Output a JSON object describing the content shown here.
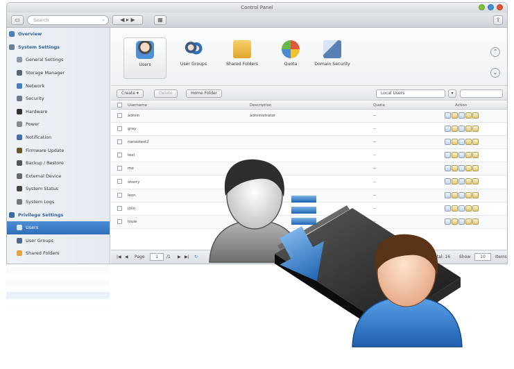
{
  "window": {
    "title": "Control Panel"
  },
  "toolbar": {
    "search_placeholder": "Search"
  },
  "sidebar": {
    "items": [
      {
        "label": "Overview",
        "level": "top",
        "icon": "overview-icon"
      },
      {
        "label": "System Settings",
        "level": "top",
        "icon": "gear-icon"
      },
      {
        "label": "General Settings",
        "level": "sub",
        "icon": "settings-icon"
      },
      {
        "label": "Storage Manager",
        "level": "sub",
        "icon": "storage-icon"
      },
      {
        "label": "Network",
        "level": "sub",
        "icon": "network-icon"
      },
      {
        "label": "Security",
        "level": "sub",
        "icon": "lock-icon"
      },
      {
        "label": "Hardware",
        "level": "sub",
        "icon": "hardware-icon"
      },
      {
        "label": "Power",
        "level": "sub",
        "icon": "power-icon"
      },
      {
        "label": "Notification",
        "level": "sub",
        "icon": "notification-icon"
      },
      {
        "label": "Firmware Update",
        "level": "sub",
        "icon": "firmware-icon"
      },
      {
        "label": "Backup / Restore",
        "level": "sub",
        "icon": "backup-icon"
      },
      {
        "label": "External Device",
        "level": "sub",
        "icon": "external-device-icon"
      },
      {
        "label": "System Status",
        "level": "sub",
        "icon": "status-icon"
      },
      {
        "label": "System Logs",
        "level": "sub",
        "icon": "logs-icon"
      },
      {
        "label": "Privilege Settings",
        "level": "top",
        "icon": "privilege-icon"
      },
      {
        "label": "Users",
        "level": "sub",
        "icon": "user-icon",
        "selected": true
      },
      {
        "label": "User Groups",
        "level": "sub",
        "icon": "user-group-icon"
      },
      {
        "label": "Shared Folders",
        "level": "sub",
        "icon": "folder-icon"
      }
    ]
  },
  "icons": [
    {
      "label": "Users",
      "color": "#f2dcc8"
    },
    {
      "label": "User Groups",
      "color": "#7a9cc2"
    },
    {
      "label": "Shared Folders",
      "color": "#e8b84a"
    },
    {
      "label": "Quota",
      "color": "#e05a3a"
    },
    {
      "label": "Domain Security",
      "color": "#5a7fb5"
    }
  ],
  "actions": {
    "create": "Create",
    "delete": "Delete",
    "home_folder": "Home Folder",
    "filter": "Local Users"
  },
  "grid": {
    "headers": {
      "username": "Username",
      "description": "Description",
      "quota": "Quota",
      "action": "Action"
    },
    "rows": [
      {
        "username": "admin",
        "description": "administrator",
        "quota": "--"
      },
      {
        "username": "gray",
        "description": "",
        "quota": "--"
      },
      {
        "username": "nanastest2",
        "description": "",
        "quota": "--"
      },
      {
        "username": "test",
        "description": "",
        "quota": "--"
      },
      {
        "username": "mo",
        "description": "",
        "quota": "--"
      },
      {
        "username": "sherry",
        "description": "",
        "quota": "--"
      },
      {
        "username": "leon",
        "description": "",
        "quota": "--"
      },
      {
        "username": "jolin",
        "description": "",
        "quota": "--"
      },
      {
        "username": "louie",
        "description": "",
        "quota": "--"
      }
    ]
  },
  "pager": {
    "page_label": "Page",
    "page": "1",
    "of": "/1",
    "summary": "1-16, Total: 16",
    "show_label": "Show",
    "show_value": "10",
    "items_label": "Items"
  },
  "colors": {
    "selected": "#3a78c3",
    "accent": "#2f5f98"
  }
}
